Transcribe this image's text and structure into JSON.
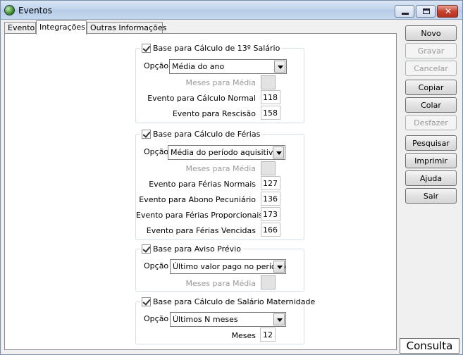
{
  "window": {
    "title": "Eventos"
  },
  "tabs": [
    "Evento",
    "Integrações",
    "Outras Informações"
  ],
  "active_tab": "Integrações",
  "sections": {
    "decimo": {
      "title": "Base para Cálculo de 13º Salário",
      "checked": true,
      "opcao_label": "Opção",
      "opcao_value": "Média do ano",
      "meses_label": "Meses para Média",
      "rows": [
        {
          "label": "Evento para Cálculo Normal",
          "value": "118"
        },
        {
          "label": "Evento para Rescisão",
          "value": "158"
        }
      ]
    },
    "ferias": {
      "title": "Base para Cálculo de Férias",
      "checked": true,
      "opcao_label": "Opção",
      "opcao_value": "Média do período aquisitivo",
      "meses_label": "Meses para Média",
      "rows": [
        {
          "label": "Evento para Férias Normais",
          "value": "127"
        },
        {
          "label": "Evento para Abono Pecuniário",
          "value": "136"
        },
        {
          "label": "Evento para Férias Proporcionais",
          "value": "173"
        },
        {
          "label": "Evento para Férias Vencidas",
          "value": "166"
        }
      ]
    },
    "aviso": {
      "title": "Base para Aviso Prévio",
      "checked": true,
      "opcao_label": "Opção",
      "opcao_value": "Último valor pago no período",
      "meses_label": "Meses para Média"
    },
    "maternidade": {
      "title": "Base para Cálculo de Salário Maternidade",
      "checked": true,
      "opcao_label": "Opção",
      "opcao_value": "Últimos N meses",
      "meses_label": "Meses",
      "meses_value": "12"
    }
  },
  "buttons": {
    "novo": "Novo",
    "gravar": "Gravar",
    "cancelar": "Cancelar",
    "copiar": "Copiar",
    "colar": "Colar",
    "desfazer": "Desfazer",
    "pesquisar": "Pesquisar",
    "imprimir": "Imprimir",
    "ajuda": "Ajuda",
    "sair": "Sair"
  },
  "status": {
    "mode": "Consulta"
  }
}
